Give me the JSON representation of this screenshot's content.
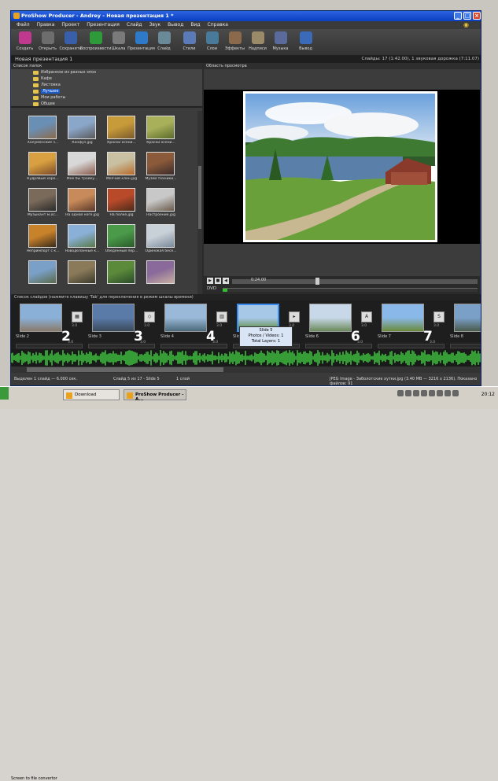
{
  "window": {
    "title": "ProShow Producer - Andrey - Новая презентация 1 *"
  },
  "menu": [
    "Файл",
    "Правка",
    "Проект",
    "Презентация",
    "Слайд",
    "Звук",
    "Вывод",
    "Вид",
    "Справка"
  ],
  "toolbar": [
    {
      "label": "Создать",
      "icon": "create-icon",
      "color": "#c0398f"
    },
    {
      "label": "Открыть",
      "icon": "open-icon",
      "color": "#6d6d6d"
    },
    {
      "label": "Сохранить",
      "icon": "save-icon",
      "color": "#3a5faa"
    },
    {
      "label": "Воспроизвести",
      "icon": "play-icon",
      "color": "#2f9a3a"
    },
    {
      "label": "Шкала",
      "icon": "timeline-icon",
      "color": "#7a7a7a"
    },
    {
      "label": "Презентация",
      "icon": "show-icon",
      "color": "#2f7ac8"
    },
    {
      "label": "Слайд",
      "icon": "slide-icon",
      "color": "#6a8a9a"
    },
    {
      "label": "Стили",
      "icon": "styles-icon",
      "color": "#5a7ab8"
    },
    {
      "label": "Слои",
      "icon": "layers-icon",
      "color": "#4a7a9a"
    },
    {
      "label": "Эффекты",
      "icon": "effects-icon",
      "color": "#8a6a4a"
    },
    {
      "label": "Надписи",
      "icon": "captions-icon",
      "color": "#9a8a6a"
    },
    {
      "label": "Музыка",
      "icon": "music-icon",
      "color": "#5a6a9a"
    },
    {
      "label": "Вывод",
      "icon": "output-icon",
      "color": "#3a6ab8"
    }
  ],
  "project": {
    "name": "Новая презентация 1",
    "summary": "Слайды: 17 (1:42.00), 1 звуковая дорожка (7:11.07)"
  },
  "folders": {
    "header": "Список папок",
    "items": [
      "Избранное из разных эпох",
      "Кафе",
      "Листовка",
      "Лучшее",
      "Мои работы",
      "Общее"
    ],
    "selected_index": 3
  },
  "files": [
    {
      "name": "Холуменские з...",
      "colors": [
        "#6a8fb5",
        "#8a6a4a"
      ]
    },
    {
      "name": "Конфуз.jpg",
      "colors": [
        "#8aa6c8",
        "#5a5a5a"
      ]
    },
    {
      "name": "Краски осени...",
      "colors": [
        "#c79a3a",
        "#7a5a2a"
      ]
    },
    {
      "name": "Краски осени...",
      "colors": [
        "#a8b05a",
        "#5a6a2a"
      ]
    },
    {
      "name": "Кудрявый хоро...",
      "colors": [
        "#d8a040",
        "#7a4a2a"
      ]
    },
    {
      "name": "Мне бы тройку...",
      "colors": [
        "#d8d8d8",
        "#8a5a4a"
      ]
    },
    {
      "name": "Молчий клен.jpg",
      "colors": [
        "#c8c0a0",
        "#b86a2a"
      ]
    },
    {
      "name": "Музей техники...",
      "colors": [
        "#8a5a3a",
        "#3a2a2a"
      ]
    },
    {
      "name": "Музыкант м.ос...",
      "colors": [
        "#7a6a5a",
        "#2a2a2a"
      ]
    },
    {
      "name": "На одной ноге.jpg",
      "colors": [
        "#c88a5a",
        "#5a3a2a"
      ]
    },
    {
      "name": "На полке.jpg",
      "colors": [
        "#b84a2a",
        "#4a2a1a"
      ]
    },
    {
      "name": "Настроение.jpg",
      "colors": [
        "#c8c8c8",
        "#6a5a4a"
      ]
    },
    {
      "name": "Непримпорт с к...",
      "colors": [
        "#c8822a",
        "#3a2a1a"
      ]
    },
    {
      "name": "Новоделанные к...",
      "colors": [
        "#8ab0d8",
        "#5a7a4a"
      ]
    },
    {
      "name": "Обеденный пер...",
      "colors": [
        "#4a9a4a",
        "#2a5a2a"
      ]
    },
    {
      "name": "Одинокая бесе...",
      "colors": [
        "#c8d0d8",
        "#7a8a9a"
      ]
    },
    {
      "name": "",
      "colors": [
        "#7aa0c8",
        "#5a6a4a"
      ]
    },
    {
      "name": "",
      "colors": [
        "#8a7a5a",
        "#3a3a2a"
      ]
    },
    {
      "name": "",
      "colors": [
        "#5a8a3a",
        "#2a4a2a"
      ]
    },
    {
      "name": "",
      "colors": [
        "#8a6a9a",
        "#c8b0a0"
      ]
    }
  ],
  "preview": {
    "header": "Область просмотра",
    "timecode": "0:24.00",
    "dvd_label": "DVD",
    "dvd_fill_fraction": 0.02,
    "scrub_fraction": 0.34
  },
  "slide_list": {
    "header": "Список слайдов (нажмите клавишу 'Tab' для переключения в режим шкалы времени)",
    "slides": [
      {
        "name": "Slide 2",
        "num": "2",
        "dur": "3.0",
        "trans_dur": "3.0",
        "colors": [
          "#8ab0d8",
          "#8a7a6a"
        ],
        "trans": "▦"
      },
      {
        "name": "Slide 3",
        "num": "3",
        "dur": "3.0",
        "trans_dur": "3.0",
        "colors": [
          "#5a7aa8",
          "#3a4a5a"
        ],
        "trans": "◇"
      },
      {
        "name": "Slide 4",
        "num": "4",
        "dur": "3.0",
        "trans_dur": "3.0",
        "colors": [
          "#9ab8d8",
          "#4a6a7a"
        ],
        "trans": "▥"
      },
      {
        "name": "Slide 5",
        "num": "5",
        "dur": "3.0",
        "trans_dur": "3.0",
        "colors": [
          "#a8c8e8",
          "#5a8a3a"
        ],
        "trans": "▸"
      },
      {
        "name": "Slide 6",
        "num": "6",
        "dur": "3.0",
        "trans_dur": "3.0",
        "colors": [
          "#c8d8e8",
          "#6a8a5a"
        ],
        "trans": "A"
      },
      {
        "name": "Slide 7",
        "num": "7",
        "dur": "3.0",
        "trans_dur": "3.0",
        "colors": [
          "#8ab8e8",
          "#6a8a3a"
        ],
        "trans": "S"
      },
      {
        "name": "Slide 8",
        "num": "8",
        "dur": "",
        "trans_dur": "",
        "colors": [
          "#7aa0c8",
          "#4a5a4a"
        ],
        "trans": ""
      }
    ],
    "selected_index": 3,
    "tooltip": [
      "Slide 5",
      "Photos / Videos: 1",
      "Total Layers: 1"
    ]
  },
  "status": {
    "selection": "Выделен 1 слайд — 6.000 сек.",
    "position": "Слайд 5 из 17 - Slide 5",
    "layers": "1 слой",
    "file_info": "JPEG Image - Заболотские хутки.jpg (3.40 MB — 3216 x 2136). Показано файлов: 91"
  },
  "taskbar": {
    "screentip": "Screen to file convertor",
    "tasks": [
      "Download",
      "ProShow Producer - A..."
    ],
    "clock": "20:12"
  }
}
